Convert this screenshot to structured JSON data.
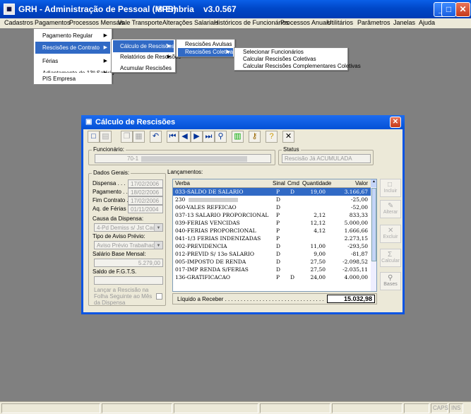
{
  "window": {
    "title": "GRH - Administração de Pessoal (MPS)",
    "brand": "® Embria",
    "version": "v3.0.567"
  },
  "menubar": [
    "Cadastros",
    "Pagamentos",
    "Processos Mensais",
    "Vale Transporte",
    "Alterações Salariais",
    "Históricos de Funcionários",
    "Processos Anuais",
    "Utilitários",
    "Parâmetros",
    "Janelas",
    "Ajuda"
  ],
  "menu1": [
    "Pagamento Regular",
    "Rescisões de Contrato",
    "Férias",
    "Adiantamento de 13º Salário",
    "PIS Empresa"
  ],
  "menu2": [
    "Cálculo de Rescisões",
    "Relatórios de Rescisões",
    "Acumular Rescisões"
  ],
  "menu3": [
    "Rescisões Avulsas",
    "Rescisões Coletivas"
  ],
  "menu4": [
    "Selecionar Funcionários",
    "Calcular Rescisões Coletivas",
    "Calcular Rescisões Complementares Coletivas"
  ],
  "dialog": {
    "title": "Cálculo de Rescisões"
  },
  "funcionario": {
    "label": "Funcionário:",
    "value": "70-1"
  },
  "status": {
    "label": "Status",
    "value": "Rescisão Já ACUMULADA"
  },
  "dados": {
    "label": "Dados Gerais:",
    "dispensa_label": "Dispensa . . .",
    "dispensa": "17/02/2006",
    "pagamento_label": "Pagamento . .",
    "pagamento": "18/02/2006",
    "fim_label": "Fim Contrato .",
    "fim": "17/02/2006",
    "aq_label": "Aq. de Férias",
    "aq": "01/11/2004",
    "causa_label": "Causa da Dispensa:",
    "causa": "4-Pd Demiss s/ Jst Causa",
    "aviso_label": "Tipo de Aviso Prévio:",
    "aviso": "Aviso Prévio Trabalhado",
    "salario_label": "Salário Base Mensal:",
    "salario": "5.279,00",
    "fgts_label": "Saldo de F.G.T.S.",
    "lancar": "Lançar a Rescisão na Folha Seguinte ao Mês da Dispensa"
  },
  "lancamentos": {
    "label": "Lançamentos:",
    "columns": [
      "Verba",
      "Sinal",
      "Cmd",
      "Quantidade",
      "Valor"
    ],
    "rows": [
      {
        "verba": "033-SALDO DE SALARIO",
        "sinal": "P",
        "cmd": "D",
        "qtd": "19,00",
        "valor": "3.166,67"
      },
      {
        "verba": "230",
        "sinal": "D",
        "cmd": "",
        "qtd": "",
        "valor": "-25,00"
      },
      {
        "verba": "060-VALES REFEICAO",
        "sinal": "D",
        "cmd": "",
        "qtd": "",
        "valor": "-52,00"
      },
      {
        "verba": "037-13 SALARIO PROPORCIONAL",
        "sinal": "P",
        "cmd": "",
        "qtd": "2,12",
        "valor": "833,33"
      },
      {
        "verba": "039-FERIAS VENCIDAS",
        "sinal": "P",
        "cmd": "",
        "qtd": "12,12",
        "valor": "5.000,00"
      },
      {
        "verba": "040-FERIAS PROPORCIONAL",
        "sinal": "P",
        "cmd": "",
        "qtd": "4,12",
        "valor": "1.666,66"
      },
      {
        "verba": "041-1/3 FERIAS INDENIZADAS",
        "sinal": "P",
        "cmd": "",
        "qtd": "",
        "valor": "2.273,15"
      },
      {
        "verba": "002-PREVIDENCIA",
        "sinal": "D",
        "cmd": "",
        "qtd": "11,00",
        "valor": "-293,50"
      },
      {
        "verba": "012-PREVID S/ 13o SALARIO",
        "sinal": "D",
        "cmd": "",
        "qtd": "9,00",
        "valor": "-81,87"
      },
      {
        "verba": "005-IMPOSTO DE RENDA",
        "sinal": "D",
        "cmd": "",
        "qtd": "27,50",
        "valor": "-2.098,52"
      },
      {
        "verba": "017-IMP RENDA S/FERIAS",
        "sinal": "D",
        "cmd": "",
        "qtd": "27,50",
        "valor": "-2.035,11"
      },
      {
        "verba": "136-GRATIFICACAO",
        "sinal": "P",
        "cmd": "D",
        "qtd": "24,00",
        "valor": "4.000,00"
      }
    ],
    "liquido_label": "Líquido a Receber . . . . . . . . . . . . . . . . . . . . . . . . . . . . . . . .",
    "liquido": "15.032,98"
  },
  "buttons": [
    "Incluir",
    "Alterar",
    "Excluir",
    "Calcular",
    "Bases"
  ],
  "statusbar": {
    "caps": "CAPS",
    "ins": "INS"
  },
  "icons": [
    "grh-app-icon",
    "new-icon",
    "save-icon",
    "copy-icon",
    "paste-icon",
    "undo-icon",
    "first-icon",
    "prev-icon",
    "next-icon",
    "last-icon",
    "find-icon",
    "calculator-icon",
    "key-icon",
    "help-icon",
    "cancel-icon"
  ]
}
